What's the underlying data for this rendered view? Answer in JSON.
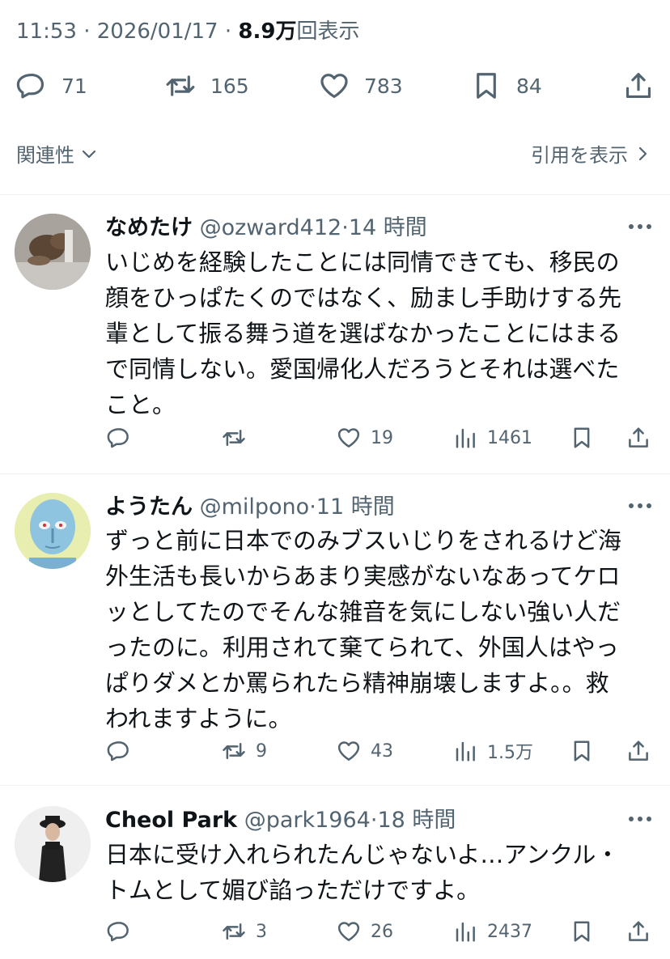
{
  "tweet": {
    "time": "11:53",
    "date": "2026/01/17",
    "views_count": "8.9万",
    "views_label": "回表示",
    "replies": "71",
    "retweets": "165",
    "likes": "783",
    "bookmarks": "84"
  },
  "related_label": "関連性",
  "quotes_label": "引用を表示",
  "replies": [
    {
      "name": "なめたけ",
      "handle": "@ozward412",
      "age": "14 時間",
      "text": "いじめを経験したことには同情できても、移民の\n顔をひっぱたくのではなく、励まし手助けする先\n輩として振る舞う道を選ばなかったことにはまる\nで同情しない。愛国帰化人だろうとそれは選べた\nこと。",
      "retweets": "",
      "likes": "19",
      "views": "1461"
    },
    {
      "name": "ようたん",
      "handle": "@milpono",
      "age": "11 時間",
      "text": "ずっと前に日本でのみブスいじりをされるけど海\n外生活も長いからあまり実感がないなあってケロ\nッとしてたのでそんな雑音を気にしない強い人だ\nったのに。利用されて棄てられて、外国人はやっ\nぱりダメとか罵られたら精神崩壊しますよ。。救\nわれますように。",
      "retweets": "9",
      "likes": "43",
      "views": "1.5万"
    },
    {
      "name": "Cheol Park",
      "handle": "@park1964",
      "age": "18 時間",
      "text": "日本に受け入れられたんじゃないよ…アンクル・\nトムとして媚び諂っただけですよ。",
      "retweets": "3",
      "likes": "26",
      "views": "2437"
    }
  ]
}
